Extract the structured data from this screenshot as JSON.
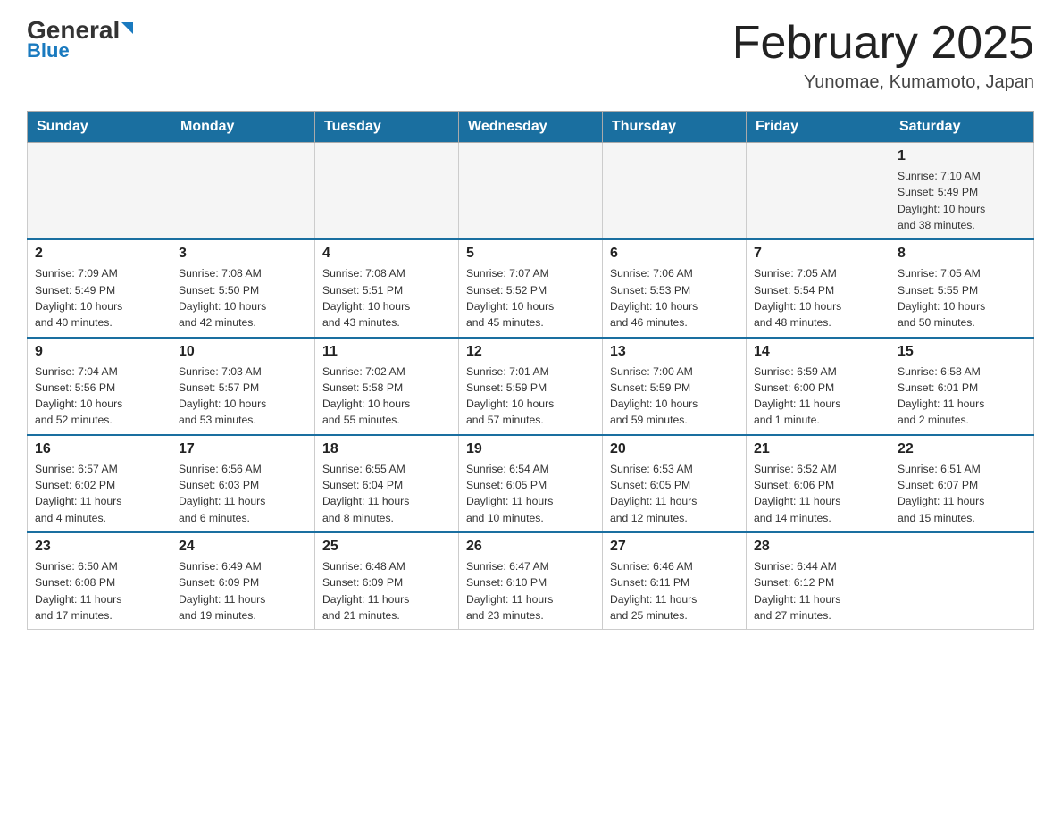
{
  "header": {
    "logo": {
      "general": "General",
      "blue": "Blue"
    },
    "title": "February 2025",
    "location": "Yunomae, Kumamoto, Japan"
  },
  "weekdays": [
    "Sunday",
    "Monday",
    "Tuesday",
    "Wednesday",
    "Thursday",
    "Friday",
    "Saturday"
  ],
  "weeks": [
    [
      {
        "day": "",
        "info": ""
      },
      {
        "day": "",
        "info": ""
      },
      {
        "day": "",
        "info": ""
      },
      {
        "day": "",
        "info": ""
      },
      {
        "day": "",
        "info": ""
      },
      {
        "day": "",
        "info": ""
      },
      {
        "day": "1",
        "info": "Sunrise: 7:10 AM\nSunset: 5:49 PM\nDaylight: 10 hours\nand 38 minutes."
      }
    ],
    [
      {
        "day": "2",
        "info": "Sunrise: 7:09 AM\nSunset: 5:49 PM\nDaylight: 10 hours\nand 40 minutes."
      },
      {
        "day": "3",
        "info": "Sunrise: 7:08 AM\nSunset: 5:50 PM\nDaylight: 10 hours\nand 42 minutes."
      },
      {
        "day": "4",
        "info": "Sunrise: 7:08 AM\nSunset: 5:51 PM\nDaylight: 10 hours\nand 43 minutes."
      },
      {
        "day": "5",
        "info": "Sunrise: 7:07 AM\nSunset: 5:52 PM\nDaylight: 10 hours\nand 45 minutes."
      },
      {
        "day": "6",
        "info": "Sunrise: 7:06 AM\nSunset: 5:53 PM\nDaylight: 10 hours\nand 46 minutes."
      },
      {
        "day": "7",
        "info": "Sunrise: 7:05 AM\nSunset: 5:54 PM\nDaylight: 10 hours\nand 48 minutes."
      },
      {
        "day": "8",
        "info": "Sunrise: 7:05 AM\nSunset: 5:55 PM\nDaylight: 10 hours\nand 50 minutes."
      }
    ],
    [
      {
        "day": "9",
        "info": "Sunrise: 7:04 AM\nSunset: 5:56 PM\nDaylight: 10 hours\nand 52 minutes."
      },
      {
        "day": "10",
        "info": "Sunrise: 7:03 AM\nSunset: 5:57 PM\nDaylight: 10 hours\nand 53 minutes."
      },
      {
        "day": "11",
        "info": "Sunrise: 7:02 AM\nSunset: 5:58 PM\nDaylight: 10 hours\nand 55 minutes."
      },
      {
        "day": "12",
        "info": "Sunrise: 7:01 AM\nSunset: 5:59 PM\nDaylight: 10 hours\nand 57 minutes."
      },
      {
        "day": "13",
        "info": "Sunrise: 7:00 AM\nSunset: 5:59 PM\nDaylight: 10 hours\nand 59 minutes."
      },
      {
        "day": "14",
        "info": "Sunrise: 6:59 AM\nSunset: 6:00 PM\nDaylight: 11 hours\nand 1 minute."
      },
      {
        "day": "15",
        "info": "Sunrise: 6:58 AM\nSunset: 6:01 PM\nDaylight: 11 hours\nand 2 minutes."
      }
    ],
    [
      {
        "day": "16",
        "info": "Sunrise: 6:57 AM\nSunset: 6:02 PM\nDaylight: 11 hours\nand 4 minutes."
      },
      {
        "day": "17",
        "info": "Sunrise: 6:56 AM\nSunset: 6:03 PM\nDaylight: 11 hours\nand 6 minutes."
      },
      {
        "day": "18",
        "info": "Sunrise: 6:55 AM\nSunset: 6:04 PM\nDaylight: 11 hours\nand 8 minutes."
      },
      {
        "day": "19",
        "info": "Sunrise: 6:54 AM\nSunset: 6:05 PM\nDaylight: 11 hours\nand 10 minutes."
      },
      {
        "day": "20",
        "info": "Sunrise: 6:53 AM\nSunset: 6:05 PM\nDaylight: 11 hours\nand 12 minutes."
      },
      {
        "day": "21",
        "info": "Sunrise: 6:52 AM\nSunset: 6:06 PM\nDaylight: 11 hours\nand 14 minutes."
      },
      {
        "day": "22",
        "info": "Sunrise: 6:51 AM\nSunset: 6:07 PM\nDaylight: 11 hours\nand 15 minutes."
      }
    ],
    [
      {
        "day": "23",
        "info": "Sunrise: 6:50 AM\nSunset: 6:08 PM\nDaylight: 11 hours\nand 17 minutes."
      },
      {
        "day": "24",
        "info": "Sunrise: 6:49 AM\nSunset: 6:09 PM\nDaylight: 11 hours\nand 19 minutes."
      },
      {
        "day": "25",
        "info": "Sunrise: 6:48 AM\nSunset: 6:09 PM\nDaylight: 11 hours\nand 21 minutes."
      },
      {
        "day": "26",
        "info": "Sunrise: 6:47 AM\nSunset: 6:10 PM\nDaylight: 11 hours\nand 23 minutes."
      },
      {
        "day": "27",
        "info": "Sunrise: 6:46 AM\nSunset: 6:11 PM\nDaylight: 11 hours\nand 25 minutes."
      },
      {
        "day": "28",
        "info": "Sunrise: 6:44 AM\nSunset: 6:12 PM\nDaylight: 11 hours\nand 27 minutes."
      },
      {
        "day": "",
        "info": ""
      }
    ]
  ]
}
